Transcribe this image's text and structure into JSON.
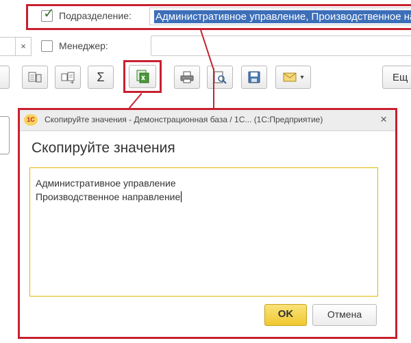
{
  "filters": {
    "department_label": "Подразделение:",
    "department_value": "Административное управление, Производственное направление",
    "department_checked": true,
    "manager_label": "Менеджер:",
    "manager_checked": false,
    "left_clear_label": "×"
  },
  "toolbar": {
    "buttons": [
      "select-columns-icon",
      "group-icon",
      "sum-icon",
      "copy-values-icon",
      "print-icon",
      "preview-icon",
      "save-icon",
      "email-icon"
    ],
    "sum_symbol": "Σ",
    "dropdown_arrow": "▾",
    "more_label": "Ещ"
  },
  "dialog": {
    "logo_text": "1С",
    "window_title": "Скопируйте значения - Демонстрационная база / 1С... (1С:Предприятие)",
    "close_symbol": "×",
    "heading": "Скопируйте значения",
    "lines": [
      "Административное управление",
      "Производственное направление"
    ],
    "ok_label": "OK",
    "cancel_label": "Отмена"
  },
  "colors": {
    "highlight": "#c8202e",
    "selection": "#3d6fb8",
    "ok_button": "#f0c830",
    "textarea_border": "#e0b800"
  }
}
